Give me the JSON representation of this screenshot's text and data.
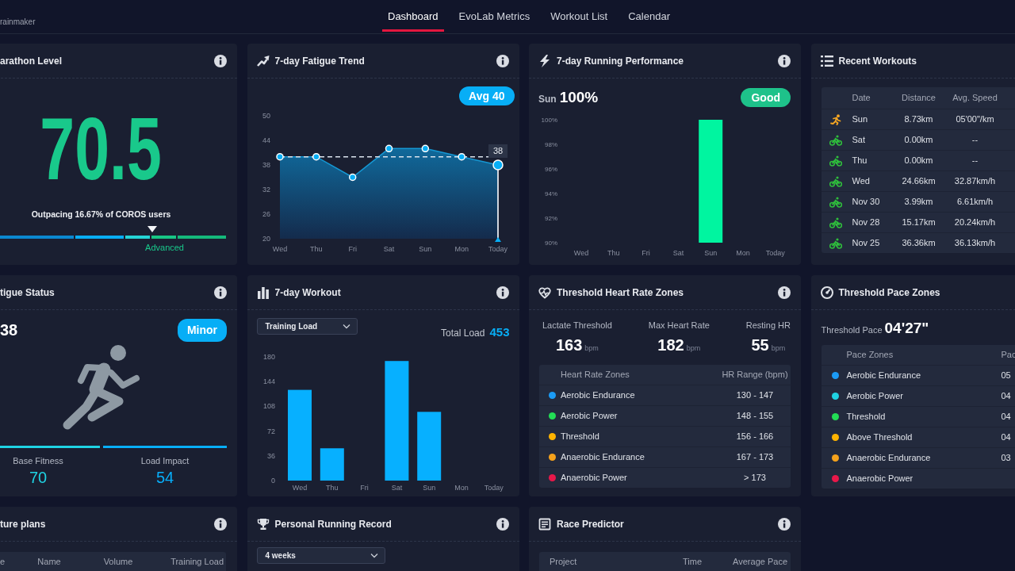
{
  "header": {
    "user_name": "rainmaker",
    "nav_tabs": [
      {
        "label": "Dashboard",
        "selected": true
      },
      {
        "label": "EvoLab Metrics",
        "selected": false
      },
      {
        "label": "Workout List",
        "selected": false
      },
      {
        "label": "Calendar",
        "selected": false
      }
    ]
  },
  "cards": [
    {
      "kind": "marathon_level",
      "title": "arathon Level",
      "info_button": true,
      "value": "70.5",
      "caption": "Outpacing 16.67% of COROS users",
      "scale": {
        "segments": [
          {
            "color": "#0b88d0"
          },
          {
            "color": "#08aef5"
          },
          {
            "color": "#25d4d6"
          },
          {
            "color": "#17c685"
          },
          {
            "color": "#14b97b"
          }
        ],
        "level": 0.705,
        "label": "Advanced"
      }
    },
    {
      "kind": "fatigue_trend",
      "title": "7-day Fatigue Trend",
      "info_button": true,
      "chart_data": {
        "type": "area",
        "categories": [
          "Wed",
          "Thu",
          "Fri",
          "Sat",
          "Sun",
          "Mon",
          "Today"
        ],
        "values": [
          40,
          40,
          35,
          42,
          42,
          40,
          38
        ],
        "ylim": [
          20,
          50
        ],
        "yticks": [
          20,
          26,
          32,
          38,
          44,
          50
        ],
        "ref_lines": [
          {
            "axis": "y",
            "value": 40,
            "label": "Avg 40"
          }
        ],
        "annotations": [
          {
            "x": "Today",
            "y": 38,
            "text": "38"
          }
        ]
      }
    },
    {
      "kind": "running_performance",
      "title": "7-day Running Performance",
      "info_button": true,
      "day": "Sun",
      "value": "100%",
      "badge": "Good",
      "chart_data": {
        "type": "bar",
        "categories": [
          "Wed",
          "Thu",
          "Fri",
          "Sat",
          "Sun",
          "Mon",
          "Today"
        ],
        "values": [
          null,
          null,
          null,
          null,
          100,
          null,
          null
        ],
        "ylim": [
          90,
          100
        ],
        "yticks": [
          {
            "value": 90,
            "label": "90%"
          },
          {
            "value": 92,
            "label": "92%"
          },
          {
            "value": 94,
            "label": "94%"
          },
          {
            "value": 96,
            "label": "96%"
          },
          {
            "value": 98,
            "label": "98%"
          },
          {
            "value": 100,
            "label": "100%"
          }
        ]
      }
    },
    {
      "kind": "recent_workouts",
      "title": "Recent Workouts",
      "table": {
        "columns": [
          "Date",
          "Distance",
          "Avg. Speed"
        ],
        "rows": [
          {
            "kind": "run",
            "date": "Sun",
            "distance": "8.73km",
            "avg_speed": "05'00\"/km"
          },
          {
            "kind": "bike",
            "date": "Sat",
            "distance": "0.00km",
            "avg_speed": "--"
          },
          {
            "kind": "bike",
            "date": "Thu",
            "distance": "0.00km",
            "avg_speed": "--"
          },
          {
            "kind": "bike",
            "date": "Wed",
            "distance": "24.66km",
            "avg_speed": "32.87km/h"
          },
          {
            "kind": "bike",
            "date": "Nov 30",
            "distance": "3.99km",
            "avg_speed": "6.61km/h"
          },
          {
            "kind": "bike",
            "date": "Nov 28",
            "distance": "15.17km",
            "avg_speed": "20.24km/h"
          },
          {
            "kind": "bike",
            "date": "Nov 25",
            "distance": "36.36km",
            "avg_speed": "36.13km/h"
          }
        ]
      }
    },
    {
      "kind": "fatigue_status",
      "title": "tigue Status",
      "info_button": true,
      "value": "38",
      "badge": "Minor",
      "stats": [
        {
          "label": "Base Fitness",
          "value": "70",
          "color": "#1fd3e3"
        },
        {
          "label": "Load Impact",
          "value": "54",
          "color": "#07aefa"
        }
      ]
    },
    {
      "kind": "weekly_workout",
      "title": "7-day Workout",
      "info_button": true,
      "dropdown": "Training Load",
      "total_label": "Total Load",
      "total_value": "453",
      "chart_data": {
        "type": "bar",
        "categories": [
          "Wed",
          "Thu",
          "Fri",
          "Sat",
          "Sun",
          "Mon",
          "Today"
        ],
        "values": [
          132,
          47,
          0,
          174,
          100,
          0,
          0
        ],
        "ylim": [
          0,
          180
        ],
        "yticks": [
          0,
          36,
          72,
          108,
          144,
          180
        ]
      }
    },
    {
      "kind": "heart_rate_zones",
      "title": "Threshold Heart Rate Zones",
      "info_button": true,
      "stats": [
        {
          "label": "Lactate Threshold",
          "value": "163",
          "unit": "bpm"
        },
        {
          "label": "Max Heart Rate",
          "value": "182",
          "unit": "bpm"
        },
        {
          "label": "Resting HR",
          "value": "55",
          "unit": "bpm"
        }
      ],
      "table": {
        "columns": [
          "Heart Rate Zones",
          "HR Range (bpm)"
        ],
        "rows": [
          {
            "zone": "Aerobic Endurance",
            "range": "130 - 147",
            "color": "#1b9bf5"
          },
          {
            "zone": "Aerobic Power",
            "range": "148 - 155",
            "color": "#22dd55"
          },
          {
            "zone": "Threshold",
            "range": "156 - 166",
            "color": "#ffb300"
          },
          {
            "zone": "Anaerobic Endurance",
            "range": "167 - 173",
            "color": "#f5a21c"
          },
          {
            "zone": "Anaerobic Power",
            "range": "> 173",
            "color": "#e8184a"
          }
        ]
      }
    },
    {
      "kind": "pace_zones",
      "title": "Threshold Pace Zones",
      "threshold_label": "Threshold Pace",
      "threshold_value": "04'27\"",
      "table": {
        "columns": [
          "Pace Zones",
          "Pac"
        ],
        "rows": [
          {
            "zone": "Aerobic Endurance",
            "pace": "05",
            "color": "#1b9bf5"
          },
          {
            "zone": "Aerobic Power",
            "pace": "04",
            "color": "#1fd3e3"
          },
          {
            "zone": "Threshold",
            "pace": "04",
            "color": "#22dd55"
          },
          {
            "zone": "Above Threshold",
            "pace": "04",
            "color": "#ffb300"
          },
          {
            "zone": "Anaerobic Endurance",
            "pace": "03",
            "color": "#f5a21c"
          },
          {
            "zone": "Anaerobic Power",
            "color": "#e8184a"
          }
        ]
      }
    },
    {
      "kind": "future_plans",
      "title": "ture plans",
      "info_button": true,
      "table": {
        "columns": [
          "e",
          "Name",
          "Volume",
          "Training Load"
        ]
      }
    },
    {
      "kind": "personal_record",
      "title": "Personal Running Record",
      "info_button": true,
      "dropdown": "4 weeks"
    },
    {
      "kind": "race_predictor",
      "title": "Race Predictor",
      "info_button": true,
      "table": {
        "columns": [
          "Project",
          "Time",
          "Average Pace"
        ]
      }
    }
  ]
}
